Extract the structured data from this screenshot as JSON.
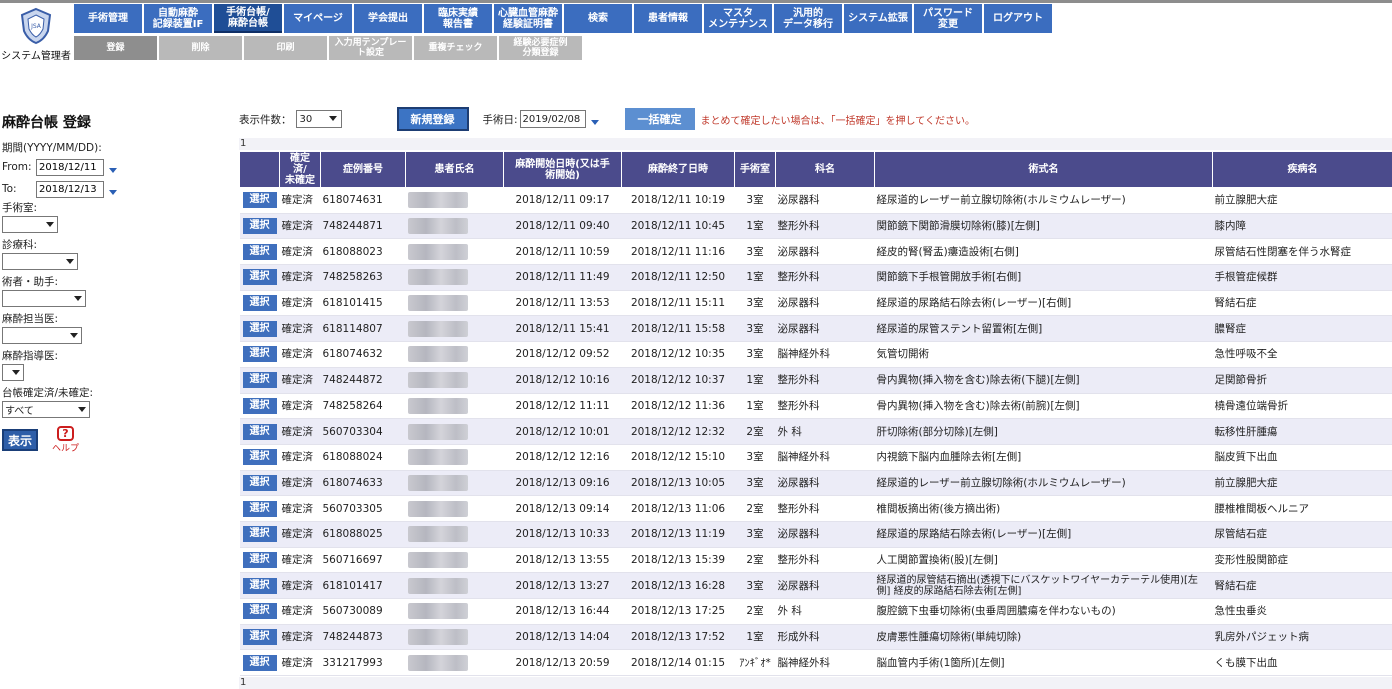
{
  "header": {
    "user_role": "システム管理者",
    "logo_text": "JSA",
    "main_nav": [
      {
        "label": "手術管理",
        "active": false
      },
      {
        "label": "自動麻酔\n記録装置IF",
        "active": false
      },
      {
        "label": "手術台帳/\n麻酔台帳",
        "active": true
      },
      {
        "label": "マイページ",
        "active": false
      },
      {
        "label": "学会提出",
        "active": false
      },
      {
        "label": "臨床実績\n報告書",
        "active": false
      },
      {
        "label": "心臓血管麻酔\n経験証明書",
        "active": false
      },
      {
        "label": "検索",
        "active": false
      },
      {
        "label": "患者情報",
        "active": false
      },
      {
        "label": "マスタ\nメンテナンス",
        "active": false
      },
      {
        "label": "汎用的\nデータ移行",
        "active": false
      },
      {
        "label": "システム拡張",
        "active": false
      },
      {
        "label": "パスワード\n変更",
        "active": false
      },
      {
        "label": "ログアウト",
        "active": false
      }
    ],
    "sub_nav": [
      {
        "label": "登録"
      },
      {
        "label": "削除"
      },
      {
        "label": "印刷"
      },
      {
        "label": "入力用テンプレー\nト設定"
      },
      {
        "label": "重複チェック"
      },
      {
        "label": "経験必要症例\n分類登録"
      }
    ]
  },
  "filter": {
    "title": "麻酔台帳 登録",
    "period_label": "期間(YYYY/MM/DD):",
    "from_label": "From:",
    "from_value": "2018/12/11",
    "to_label": "To:",
    "to_value": "2018/12/13",
    "or_label": "手術室:",
    "dept_label": "診療科:",
    "surgeon_label": "術者・助手:",
    "anes_label": "麻酔担当医:",
    "instructor_label": "麻酔指導医:",
    "status_label": "台帳確定済/未確定:",
    "status_value": "すべて",
    "show_button": "表示",
    "help_label": "ヘルプ"
  },
  "toolbar": {
    "count_label": "表示件数：",
    "count_value": "30",
    "new_button": "新規登録",
    "date_label": "手術日:",
    "date_value": "2019/02/08",
    "batch_button": "一括確定",
    "note": "まとめて確定したい場合は、「一括確定」を押してください。",
    "page_top": "1",
    "page_bottom": "1"
  },
  "table": {
    "headers": [
      "",
      "確定\n済/\n未確定",
      "症例番号",
      "患者氏名",
      "麻酔開始日時(又は手\n術開始)",
      "麻酔終了日時",
      "手術室",
      "科名",
      "術式名",
      "疾病名"
    ],
    "select_label": "選択",
    "rows": [
      {
        "status": "確定済",
        "case": "618074631",
        "start": "2018/12/11 09:17",
        "end": "2018/12/11 10:19",
        "room": "3室",
        "dept": "泌尿器科",
        "proc": "経尿道的レーザー前立腺切除術(ホルミウムレーザー)",
        "disease": "前立腺肥大症"
      },
      {
        "status": "確定済",
        "case": "748244871",
        "start": "2018/12/11 09:40",
        "end": "2018/12/11 10:45",
        "room": "1室",
        "dept": "整形外科",
        "proc": "関節鏡下関節滑膜切除術(膝)[左側]",
        "disease": "膝内障"
      },
      {
        "status": "確定済",
        "case": "618088023",
        "start": "2018/12/11 10:59",
        "end": "2018/12/11 11:16",
        "room": "3室",
        "dept": "泌尿器科",
        "proc": "経皮的腎(腎盂)瘻造設術[右側]",
        "disease": "尿管結石性閉塞を伴う水腎症"
      },
      {
        "status": "確定済",
        "case": "748258263",
        "start": "2018/12/11 11:49",
        "end": "2018/12/11 12:50",
        "room": "1室",
        "dept": "整形外科",
        "proc": "関節鏡下手根管開放手術[右側]",
        "disease": "手根管症候群"
      },
      {
        "status": "確定済",
        "case": "618101415",
        "start": "2018/12/11 13:53",
        "end": "2018/12/11 15:11",
        "room": "3室",
        "dept": "泌尿器科",
        "proc": "経尿道的尿路結石除去術(レーザー)[右側]",
        "disease": "腎結石症"
      },
      {
        "status": "確定済",
        "case": "618114807",
        "start": "2018/12/11 15:41",
        "end": "2018/12/11 15:58",
        "room": "3室",
        "dept": "泌尿器科",
        "proc": "経尿道的尿管ステント留置術[左側]",
        "disease": "膿腎症"
      },
      {
        "status": "確定済",
        "case": "618074632",
        "start": "2018/12/12 09:52",
        "end": "2018/12/12 10:35",
        "room": "3室",
        "dept": "脳神経外科",
        "proc": "気管切開術",
        "disease": "急性呼吸不全"
      },
      {
        "status": "確定済",
        "case": "748244872",
        "start": "2018/12/12 10:16",
        "end": "2018/12/12 10:37",
        "room": "1室",
        "dept": "整形外科",
        "proc": "骨内異物(挿入物を含む)除去術(下腿)[左側]",
        "disease": "足関節骨折"
      },
      {
        "status": "確定済",
        "case": "748258264",
        "start": "2018/12/12 11:11",
        "end": "2018/12/12 11:36",
        "room": "1室",
        "dept": "整形外科",
        "proc": "骨内異物(挿入物を含む)除去術(前腕)[左側]",
        "disease": "橈骨遠位端骨折"
      },
      {
        "status": "確定済",
        "case": "560703304",
        "start": "2018/12/12 10:01",
        "end": "2018/12/12 12:32",
        "room": "2室",
        "dept": "外 科",
        "proc": "肝切除術(部分切除)[左側]",
        "disease": "転移性肝腫瘍"
      },
      {
        "status": "確定済",
        "case": "618088024",
        "start": "2018/12/12 12:16",
        "end": "2018/12/12 15:10",
        "room": "3室",
        "dept": "脳神経外科",
        "proc": "内視鏡下脳内血腫除去術[左側]",
        "disease": "脳皮質下出血"
      },
      {
        "status": "確定済",
        "case": "618074633",
        "start": "2018/12/13 09:16",
        "end": "2018/12/13 10:05",
        "room": "3室",
        "dept": "泌尿器科",
        "proc": "経尿道的レーザー前立腺切除術(ホルミウムレーザー)",
        "disease": "前立腺肥大症"
      },
      {
        "status": "確定済",
        "case": "560703305",
        "start": "2018/12/13 09:14",
        "end": "2018/12/13 11:06",
        "room": "2室",
        "dept": "整形外科",
        "proc": "椎間板摘出術(後方摘出術)",
        "disease": "腰椎椎間板ヘルニア"
      },
      {
        "status": "確定済",
        "case": "618088025",
        "start": "2018/12/13 10:33",
        "end": "2018/12/13 11:19",
        "room": "3室",
        "dept": "泌尿器科",
        "proc": "経尿道的尿路結石除去術(レーザー)[左側]",
        "disease": "尿管結石症"
      },
      {
        "status": "確定済",
        "case": "560716697",
        "start": "2018/12/13 13:55",
        "end": "2018/12/13 15:39",
        "room": "2室",
        "dept": "整形外科",
        "proc": "人工関節置換術(股)[左側]",
        "disease": "変形性股関節症"
      },
      {
        "status": "確定済",
        "case": "618101417",
        "start": "2018/12/13 13:27",
        "end": "2018/12/13 16:28",
        "room": "3室",
        "dept": "泌尿器科",
        "proc": "経尿道的尿管結石摘出(透視下にバスケットワイヤーカテーテル使用)[左側] 経皮的尿路結石除去術[左側]",
        "disease": "腎結石症"
      },
      {
        "status": "確定済",
        "case": "560730089",
        "start": "2018/12/13 16:44",
        "end": "2018/12/13 17:25",
        "room": "2室",
        "dept": "外 科",
        "proc": "腹腔鏡下虫垂切除術(虫垂周囲膿瘍を伴わないもの)",
        "disease": "急性虫垂炎"
      },
      {
        "status": "確定済",
        "case": "748244873",
        "start": "2018/12/13 14:04",
        "end": "2018/12/13 17:52",
        "room": "1室",
        "dept": "形成外科",
        "proc": "皮膚悪性腫瘍切除術(単純切除)",
        "disease": "乳房外パジェット病"
      },
      {
        "status": "確定済",
        "case": "331217993",
        "start": "2018/12/13 20:59",
        "end": "2018/12/14 01:15",
        "room": "ｱﾝｷﾞｵ*",
        "dept": "脳神経外科",
        "proc": "脳血管内手術(1箇所)[左側]",
        "disease": "くも膜下出血"
      }
    ]
  }
}
